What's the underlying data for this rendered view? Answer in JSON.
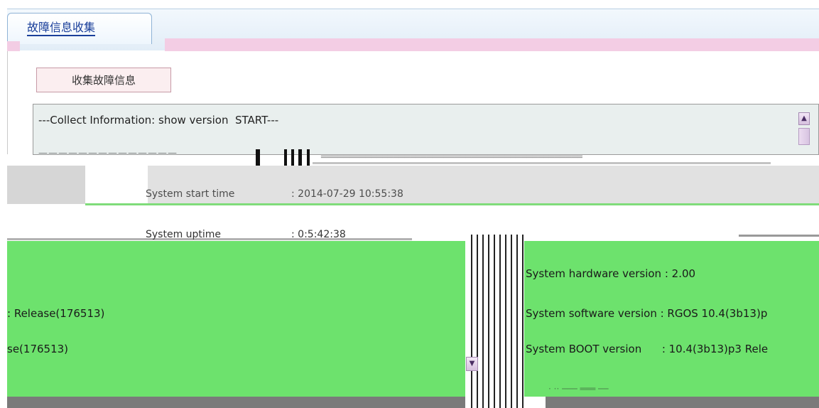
{
  "tab": {
    "label": "故障信息收集"
  },
  "collect_button": {
    "label": "收集故障信息"
  },
  "log": {
    "line1": "---Collect Information: show version  START---",
    "scroll_up_glyph": "▲",
    "scroll_down_glyph": "▼"
  },
  "version_info": {
    "start_time_label": "System start time",
    "start_time_value": ": 2014-07-29 10:55:38",
    "uptime_label": "System uptime",
    "uptime_value": ": 0:5:42:38",
    "hardware": "System hardware version : 2.00",
    "software": "System software version : RGOS 10.4(3b13)p",
    "boot": "System BOOT version      : 10.4(3b13)p3 Rele",
    "release_fragment_1": ": Release(176513)",
    "release_fragment_2": "se(176513)"
  },
  "colors": {
    "accent_pink": "#f3cde4",
    "green_bg": "#6de26d",
    "tab_text": "#1a3f9a"
  }
}
